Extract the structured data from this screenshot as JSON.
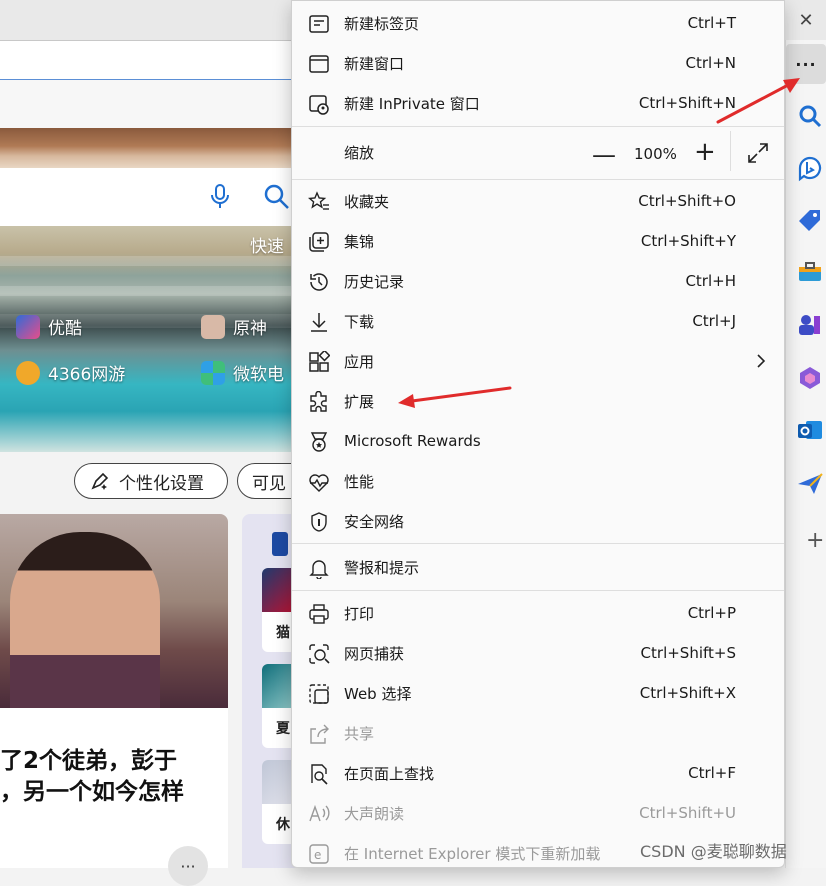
{
  "window": {
    "close_glyph": "✕"
  },
  "background": {
    "hero_quick_label": "快速",
    "tiles": [
      {
        "label": "优酷",
        "icon": "youku-icon",
        "color": "#2f6bd8"
      },
      {
        "label": "原神",
        "icon": "genshin-icon",
        "color": "#d8b9a7"
      },
      {
        "label": "4366网游",
        "icon": "4366-icon",
        "color": "#f0a82a"
      },
      {
        "label": "微软电",
        "icon": "ms-store-icon",
        "color": "#3fbf7a"
      }
    ],
    "pills": [
      {
        "label": "个性化设置",
        "icon": "personalize-icon"
      },
      {
        "label": "可见",
        "icon": ""
      }
    ],
    "card_title": "了2个徒弟，彭于，另一个如今怎样",
    "card_title_line1": "了2个徒弟，彭于",
    "card_title_line2": "，另一个如今怎样",
    "side_thumbs": [
      "猫",
      "夏",
      "休"
    ],
    "more_glyph": "···"
  },
  "sidebar": {
    "more_glyph": "···",
    "icons": [
      "search-icon",
      "bing-chat-icon",
      "shopping-tag-icon",
      "toolbox-icon",
      "games-icon",
      "microsoft365-icon",
      "outlook-icon",
      "send-icon"
    ],
    "add_glyph": "+"
  },
  "menu": {
    "items": [
      {
        "label": "新建标签页",
        "shortcut": "Ctrl+T",
        "icon": "new-tab-icon"
      },
      {
        "label": "新建窗口",
        "shortcut": "Ctrl+N",
        "icon": "new-window-icon"
      },
      {
        "label": "新建 InPrivate 窗口",
        "shortcut": "Ctrl+Shift+N",
        "icon": "inprivate-icon"
      },
      {
        "label": "缩放",
        "shortcut": "",
        "icon": ""
      },
      {
        "label": "收藏夹",
        "shortcut": "Ctrl+Shift+O",
        "icon": "favorites-icon"
      },
      {
        "label": "集锦",
        "shortcut": "Ctrl+Shift+Y",
        "icon": "collections-icon"
      },
      {
        "label": "历史记录",
        "shortcut": "Ctrl+H",
        "icon": "history-icon"
      },
      {
        "label": "下载",
        "shortcut": "Ctrl+J",
        "icon": "download-icon"
      },
      {
        "label": "应用",
        "shortcut": "",
        "icon": "apps-icon"
      },
      {
        "label": "扩展",
        "shortcut": "",
        "icon": "extensions-icon"
      },
      {
        "label": "Microsoft Rewards",
        "shortcut": "",
        "icon": "rewards-icon"
      },
      {
        "label": "性能",
        "shortcut": "",
        "icon": "performance-icon"
      },
      {
        "label": "安全网络",
        "shortcut": "",
        "icon": "secure-network-icon"
      },
      {
        "label": "警报和提示",
        "shortcut": "",
        "icon": "alerts-icon"
      },
      {
        "label": "打印",
        "shortcut": "Ctrl+P",
        "icon": "print-icon"
      },
      {
        "label": "网页捕获",
        "shortcut": "Ctrl+Shift+S",
        "icon": "web-capture-icon"
      },
      {
        "label": "Web 选择",
        "shortcut": "Ctrl+Shift+X",
        "icon": "web-select-icon"
      },
      {
        "label": "共享",
        "shortcut": "",
        "icon": "share-icon",
        "disabled": true
      },
      {
        "label": "在页面上查找",
        "shortcut": "Ctrl+F",
        "icon": "find-icon"
      },
      {
        "label": "大声朗读",
        "shortcut": "Ctrl+Shift+U",
        "icon": "read-aloud-icon",
        "disabled": true
      },
      {
        "label": "在 Internet Explorer 模式下重新加载",
        "shortcut": "",
        "icon": "ie-mode-icon",
        "disabled": true
      }
    ],
    "zoom": {
      "minus": "—",
      "value": "100%",
      "plus": "+"
    }
  },
  "annotation_color": "#e02b2b",
  "watermark": "CSDN @麦聪聊数据"
}
